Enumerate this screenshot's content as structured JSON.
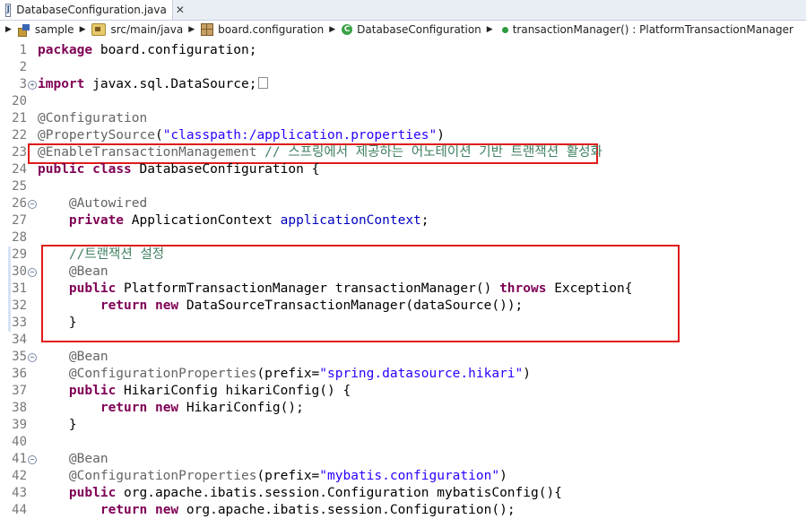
{
  "tab": {
    "title": "DatabaseConfiguration.java",
    "close": "✕",
    "icon": "java-file-icon"
  },
  "breadcrumb": {
    "items": [
      {
        "label": "sample",
        "icon": "java-project-icon"
      },
      {
        "label": "src/main/java",
        "icon": "source-folder-icon"
      },
      {
        "label": "board.configuration",
        "icon": "package-icon"
      },
      {
        "label": "DatabaseConfiguration",
        "icon": "class-icon"
      },
      {
        "label": "transactionManager() : PlatformTransactionManager",
        "icon": "public-method-icon"
      }
    ]
  },
  "editor": {
    "colors": {
      "keyword": "#7f0055",
      "annotation": "#646464",
      "string": "#2a00ff",
      "comment": "#3f7f5f",
      "field": "#0000c0",
      "highlight_box": "#e01b1b"
    },
    "lines": [
      {
        "num": "1",
        "tokens": [
          [
            "kw",
            "package"
          ],
          [
            "t",
            " board.configuration;"
          ]
        ]
      },
      {
        "num": "2",
        "tokens": []
      },
      {
        "num": "3",
        "fold": "plus",
        "tokens": [
          [
            "kw",
            "import"
          ],
          [
            "t",
            " javax.sql.DataSource;"
          ],
          [
            "box",
            ""
          ]
        ]
      },
      {
        "num": "20",
        "tokens": []
      },
      {
        "num": "21",
        "tokens": [
          [
            "ann",
            "@Configuration"
          ]
        ]
      },
      {
        "num": "22",
        "tokens": [
          [
            "ann",
            "@PropertySource"
          ],
          [
            "t",
            "("
          ],
          [
            "str",
            "\"classpath:/application.properties\""
          ],
          [
            "t",
            ")"
          ]
        ]
      },
      {
        "num": "23",
        "tokens": [
          [
            "ann",
            "@EnableTransactionManagement"
          ],
          [
            "t",
            " "
          ],
          [
            "cmt",
            "// 스프링에서 제공하는 어노테이션 기반 트랜잭션 활성화"
          ]
        ]
      },
      {
        "num": "24",
        "tokens": [
          [
            "kw",
            "public"
          ],
          [
            "t",
            " "
          ],
          [
            "kw",
            "class"
          ],
          [
            "t",
            " DatabaseConfiguration {"
          ]
        ]
      },
      {
        "num": "25",
        "tokens": []
      },
      {
        "num": "26",
        "fold": "minus",
        "tokens": [
          [
            "t",
            "    "
          ],
          [
            "ann",
            "@Autowired"
          ]
        ]
      },
      {
        "num": "27",
        "tokens": [
          [
            "t",
            "    "
          ],
          [
            "kw",
            "private"
          ],
          [
            "t",
            " ApplicationContext "
          ],
          [
            "fld",
            "applicationContext"
          ],
          [
            "t",
            ";"
          ]
        ]
      },
      {
        "num": "28",
        "tokens": []
      },
      {
        "num": "29",
        "mark": true,
        "tokens": [
          [
            "t",
            "    "
          ],
          [
            "cmt",
            "//트랜잭션 설정"
          ]
        ]
      },
      {
        "num": "30",
        "fold": "minus",
        "mark": true,
        "tokens": [
          [
            "t",
            "    "
          ],
          [
            "ann",
            "@Bean"
          ]
        ]
      },
      {
        "num": "31",
        "mark": true,
        "tokens": [
          [
            "t",
            "    "
          ],
          [
            "kw",
            "public"
          ],
          [
            "t",
            " PlatformTransactionManager transactionManager() "
          ],
          [
            "kw",
            "throws"
          ],
          [
            "t",
            " Exception{"
          ]
        ]
      },
      {
        "num": "32",
        "mark": true,
        "tokens": [
          [
            "t",
            "        "
          ],
          [
            "kw",
            "return"
          ],
          [
            "t",
            " "
          ],
          [
            "kw",
            "new"
          ],
          [
            "t",
            " DataSourceTransactionManager(dataSource());"
          ]
        ]
      },
      {
        "num": "33",
        "mark": true,
        "tokens": [
          [
            "t",
            "    }"
          ]
        ]
      },
      {
        "num": "34",
        "tokens": []
      },
      {
        "num": "35",
        "fold": "minus",
        "tokens": [
          [
            "t",
            "    "
          ],
          [
            "ann",
            "@Bean"
          ]
        ]
      },
      {
        "num": "36",
        "tokens": [
          [
            "t",
            "    "
          ],
          [
            "ann",
            "@ConfigurationProperties"
          ],
          [
            "t",
            "(prefix="
          ],
          [
            "str",
            "\"spring.datasource.hikari\""
          ],
          [
            "t",
            ")"
          ]
        ]
      },
      {
        "num": "37",
        "tokens": [
          [
            "t",
            "    "
          ],
          [
            "kw",
            "public"
          ],
          [
            "t",
            " HikariConfig hikariConfig() {"
          ]
        ]
      },
      {
        "num": "38",
        "tokens": [
          [
            "t",
            "        "
          ],
          [
            "kw",
            "return"
          ],
          [
            "t",
            " "
          ],
          [
            "kw",
            "new"
          ],
          [
            "t",
            " HikariConfig();"
          ]
        ]
      },
      {
        "num": "39",
        "tokens": [
          [
            "t",
            "    }"
          ]
        ]
      },
      {
        "num": "40",
        "tokens": []
      },
      {
        "num": "41",
        "fold": "minus",
        "tokens": [
          [
            "t",
            "    "
          ],
          [
            "ann",
            "@Bean"
          ]
        ]
      },
      {
        "num": "42",
        "tokens": [
          [
            "t",
            "    "
          ],
          [
            "ann",
            "@ConfigurationProperties"
          ],
          [
            "t",
            "(prefix="
          ],
          [
            "str",
            "\"mybatis.configuration\""
          ],
          [
            "t",
            ")"
          ]
        ]
      },
      {
        "num": "43",
        "tokens": [
          [
            "t",
            "    "
          ],
          [
            "kw",
            "public"
          ],
          [
            "t",
            " org.apache.ibatis.session.Configuration mybatisConfig(){"
          ]
        ]
      },
      {
        "num": "44",
        "tokens": [
          [
            "t",
            "        "
          ],
          [
            "kw",
            "return"
          ],
          [
            "t",
            " "
          ],
          [
            "kw",
            "new"
          ],
          [
            "t",
            " org.apache.ibatis.session.Configuration();"
          ]
        ]
      }
    ]
  }
}
